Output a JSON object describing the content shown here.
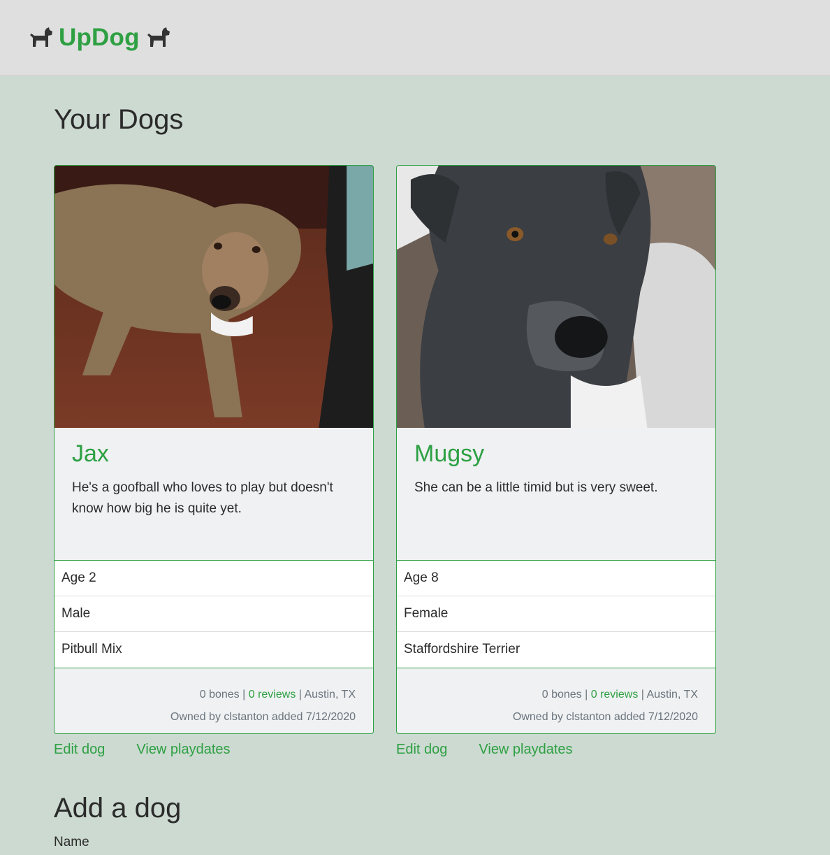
{
  "navbar": {
    "brand": "UpDog",
    "icon": "dog-icon",
    "brand_color": "#2ea043"
  },
  "page": {
    "title": "Your Dogs"
  },
  "dogs": [
    {
      "name": "Jax",
      "description": "He's a goofball who loves to play but doesn't know how big he is quite yet.",
      "age": "Age 2",
      "sex": "Male",
      "breed": "Pitbull Mix",
      "bones": "0 bones",
      "reviews": "0 reviews",
      "location": "Austin, TX",
      "owner": "Owned by clstanton added 7/12/2020",
      "edit_label": "Edit dog",
      "playdates_label": "View playdates"
    },
    {
      "name": "Mugsy",
      "description": "She can be a little timid but is very sweet.",
      "age": "Age 8",
      "sex": "Female",
      "breed": "Staffordshire Terrier",
      "bones": "0 bones",
      "reviews": "0 reviews",
      "location": "Austin, TX",
      "owner": "Owned by clstanton added 7/12/2020",
      "edit_label": "Edit dog",
      "playdates_label": "View playdates"
    }
  ],
  "add_dog": {
    "title": "Add a dog",
    "name_label": "Name"
  },
  "separator": "|"
}
